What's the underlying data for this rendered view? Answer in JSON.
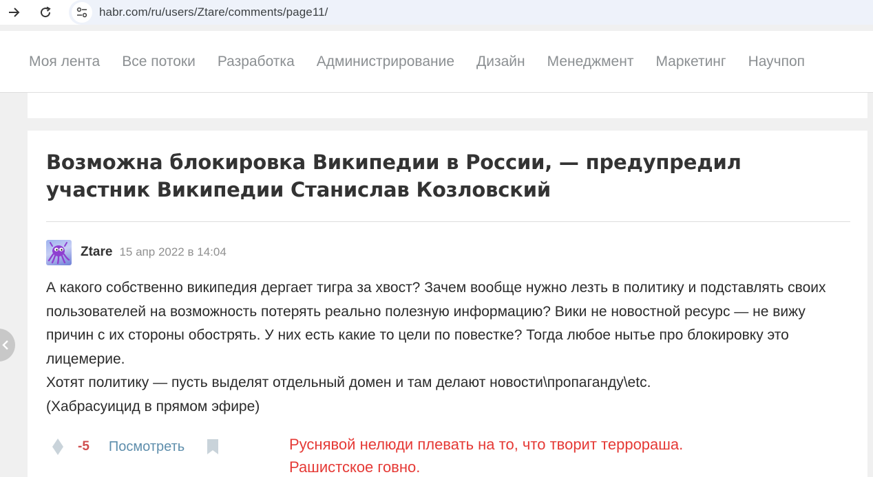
{
  "browser": {
    "url": "habr.com/ru/users/Ztare/comments/page11/"
  },
  "nav": {
    "items": [
      {
        "label": "Моя лента"
      },
      {
        "label": "Все потоки"
      },
      {
        "label": "Разработка"
      },
      {
        "label": "Администрирование"
      },
      {
        "label": "Дизайн"
      },
      {
        "label": "Менеджмент"
      },
      {
        "label": "Маркетинг"
      },
      {
        "label": "Научпоп"
      }
    ]
  },
  "comment": {
    "article_title": "Возможна блокировка Википедии в России, — предупредил участник Википедии Станислав Козловский",
    "author": "Ztare",
    "date": "15 апр 2022 в 14:04",
    "body_lines": [
      "А какого собственно википедия дергает тигра за хвост? Зачем вообще нужно лезть в политику и подставлять своих пользователей на возможность потерять реально полезную информацию? Вики не новостной ресурс — не вижу причин с их стороны обострять. У них есть какие то цели по повестке? Тогда любое нытье про блокировку это лицемерие.",
      "Хотят политику — пусть выделят отдельный домен и там делают новости\\пропаганду\\etc.",
      "(Хабрасуицид в прямом эфире)"
    ],
    "score": "-5",
    "view_label": "Посмотреть",
    "reply_note_lines": [
      "Руснявой нелюди плевать на то, что творит террораша.",
      "Рашистское говно."
    ]
  },
  "colors": {
    "score_negative": "#d04e4e",
    "link": "#5e8eac",
    "reply_note": "#e53935"
  }
}
